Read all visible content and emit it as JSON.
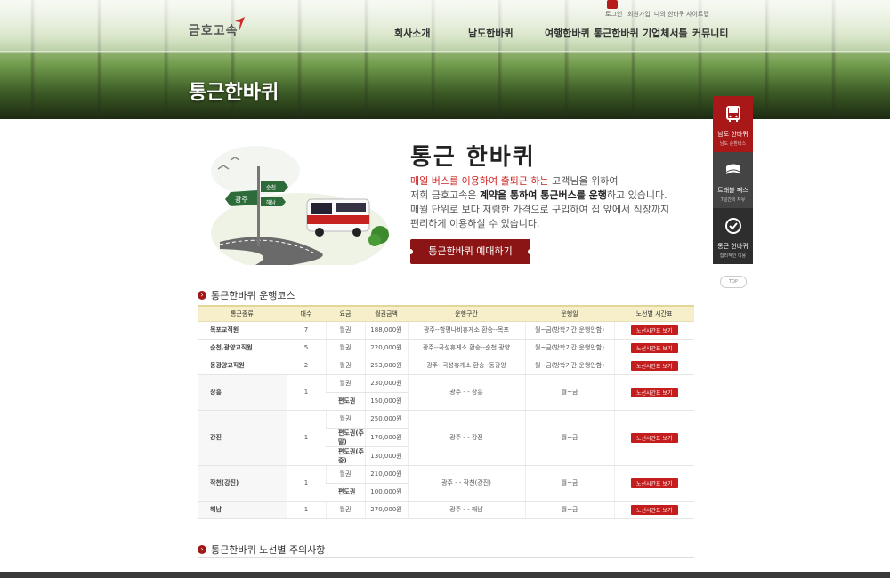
{
  "header": {
    "logo": "금호고속",
    "nav": [
      "회사소개",
      "남도한바퀴",
      "여행한바퀴",
      "통근한바퀴",
      "기업체서틀",
      "커뮤니티"
    ],
    "util": [
      "로그인",
      "회원가입",
      "나의 한바퀴",
      "사이트맵"
    ]
  },
  "hero": {
    "title": "통근한바퀴"
  },
  "intro": {
    "title": "통근 한바퀴",
    "line1_red": "매일 버스를 이용하여 출퇴근 하는",
    "line1_rest": " 고객님을 위하여",
    "line2_pre": "저희 금호고속은 ",
    "line2_bold": "계약을 통하여 통근버스를 운행",
    "line2_post": "하고 있습니다.",
    "line3": "매월 단위로 보다 저렴한 가격으로 구입하여 집 앞에서 직장까지",
    "line4": "편리하게 이용하실 수 있습니다.",
    "button": "통근한바퀴 예매하기",
    "sign1": "광주",
    "sign2": "순천",
    "sign3": "해남"
  },
  "section1": {
    "title": "통근한바퀴 운행코스"
  },
  "section2": {
    "title": "통근한바퀴 노선별 주의사항"
  },
  "table": {
    "headers": [
      "통근종류",
      "대수",
      "요금",
      "월권금액",
      "운행구간",
      "운행일",
      "노선별 시간표"
    ],
    "button_label": "노선시간표 보기",
    "rows": [
      {
        "kind": "목포교직원",
        "count": "7",
        "fee": "월권",
        "price": "188,000원",
        "route": "광주--함평나비휴게소 환승--목포",
        "days": "월~금(방학기간 운행안함)"
      },
      {
        "kind": "순천,광양교직원",
        "count": "5",
        "fee": "월권",
        "price": "220,000원",
        "route": "광주--곡성휴게소 환승--순천.광양",
        "days": "월~금(방학기간 운행안함)"
      },
      {
        "kind": "동광양교직원",
        "count": "2",
        "fee": "월권",
        "price": "253,000원",
        "route": "광주--곡성휴게소 환승--동광양",
        "days": "월~금(방학기간 운행안함)"
      },
      {
        "kind": "장흥",
        "count": "1",
        "fees": [
          "월권",
          "편도권"
        ],
        "prices": [
          "230,000원",
          "150,000원"
        ],
        "route": "광주 - - 장흥",
        "days": "월~금"
      },
      {
        "kind": "강진",
        "count": "1",
        "fees": [
          "월권",
          "편도권(주말)",
          "편도권(주중)"
        ],
        "prices": [
          "250,000원",
          "170,000원",
          "130,000원"
        ],
        "route": "광주 - - 강진",
        "days": "월~금"
      },
      {
        "kind": "작천(강진)",
        "count": "1",
        "fees": [
          "월권",
          "편도권"
        ],
        "prices": [
          "210,000원",
          "100,000원"
        ],
        "route": "광주 - - 작천(강진)",
        "days": "월~금"
      },
      {
        "kind": "해남",
        "count": "1",
        "fee": "월권",
        "price": "270,000원",
        "route": "광주 - - 해남",
        "days": "월~금"
      }
    ]
  },
  "quick": {
    "items": [
      {
        "label": "남도 한바퀴",
        "sub": "남도 순환버스",
        "color": "#a81818"
      },
      {
        "label": "트래블 패스",
        "sub": "7일간의 자유",
        "color": "#444444"
      },
      {
        "label": "통근 한바퀴",
        "sub": "합리적인 이용",
        "color": "#2e2e2e"
      }
    ],
    "top": "TOP"
  }
}
